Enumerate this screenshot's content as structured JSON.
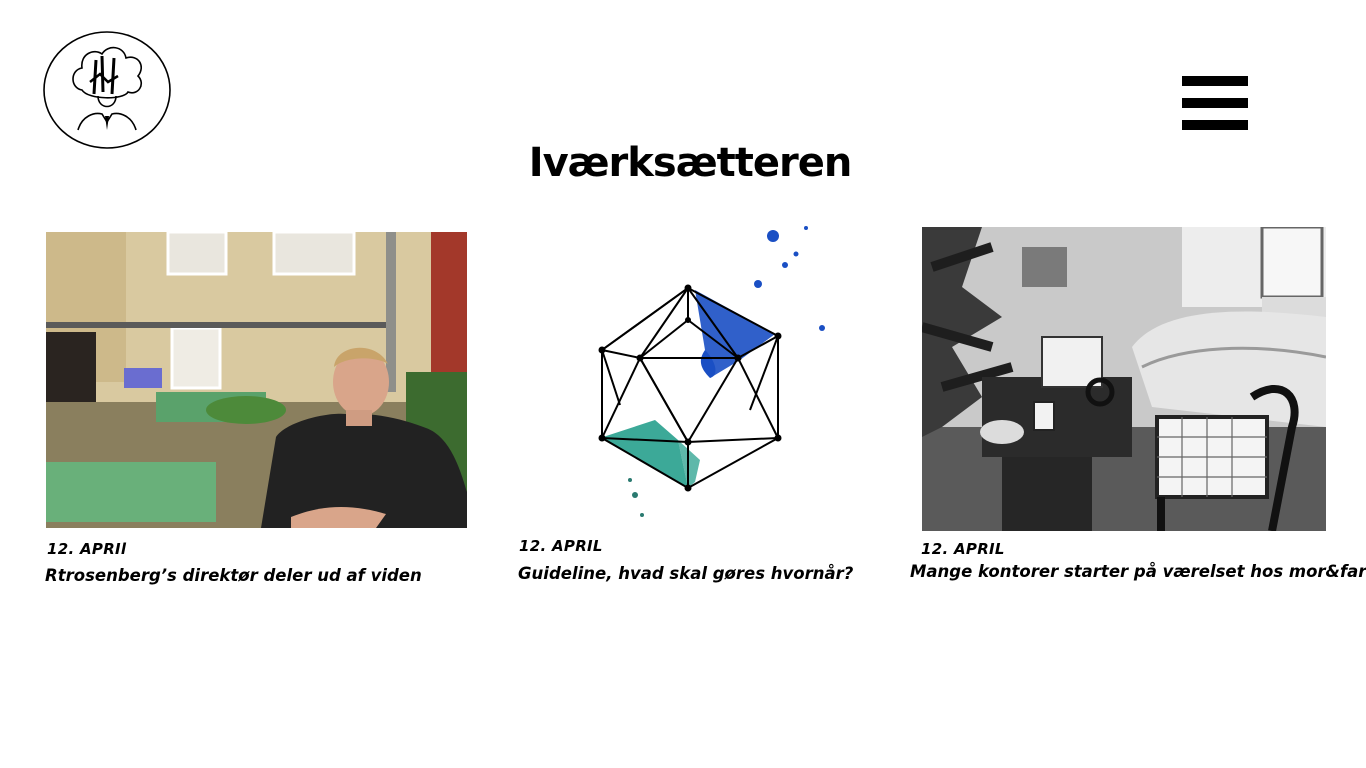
{
  "header": {
    "logo_icon": "chef-head-logo-icon",
    "menu_icon": "hamburger-menu-icon",
    "title": "Iværksætteren"
  },
  "articles": [
    {
      "date": "12. APRIl",
      "title": "Rtrosenberg’s direktør deler ud af viden",
      "image": "photo-man-in-courtyard"
    },
    {
      "date": "12. APRIL",
      "title": "Guideline, hvad skal gøres hvornår?",
      "image": "icosahedron-watercolor-illustration"
    },
    {
      "date": "12. APRIL",
      "title": "Mange kontorer starter på værelset hos mor&far",
      "image": "photo-bedroom-desk-bw"
    }
  ],
  "colors": {
    "background": "#ffffff",
    "text": "#000000",
    "accent_blue": "#1a4fc4",
    "accent_teal": "#1a9a86"
  }
}
